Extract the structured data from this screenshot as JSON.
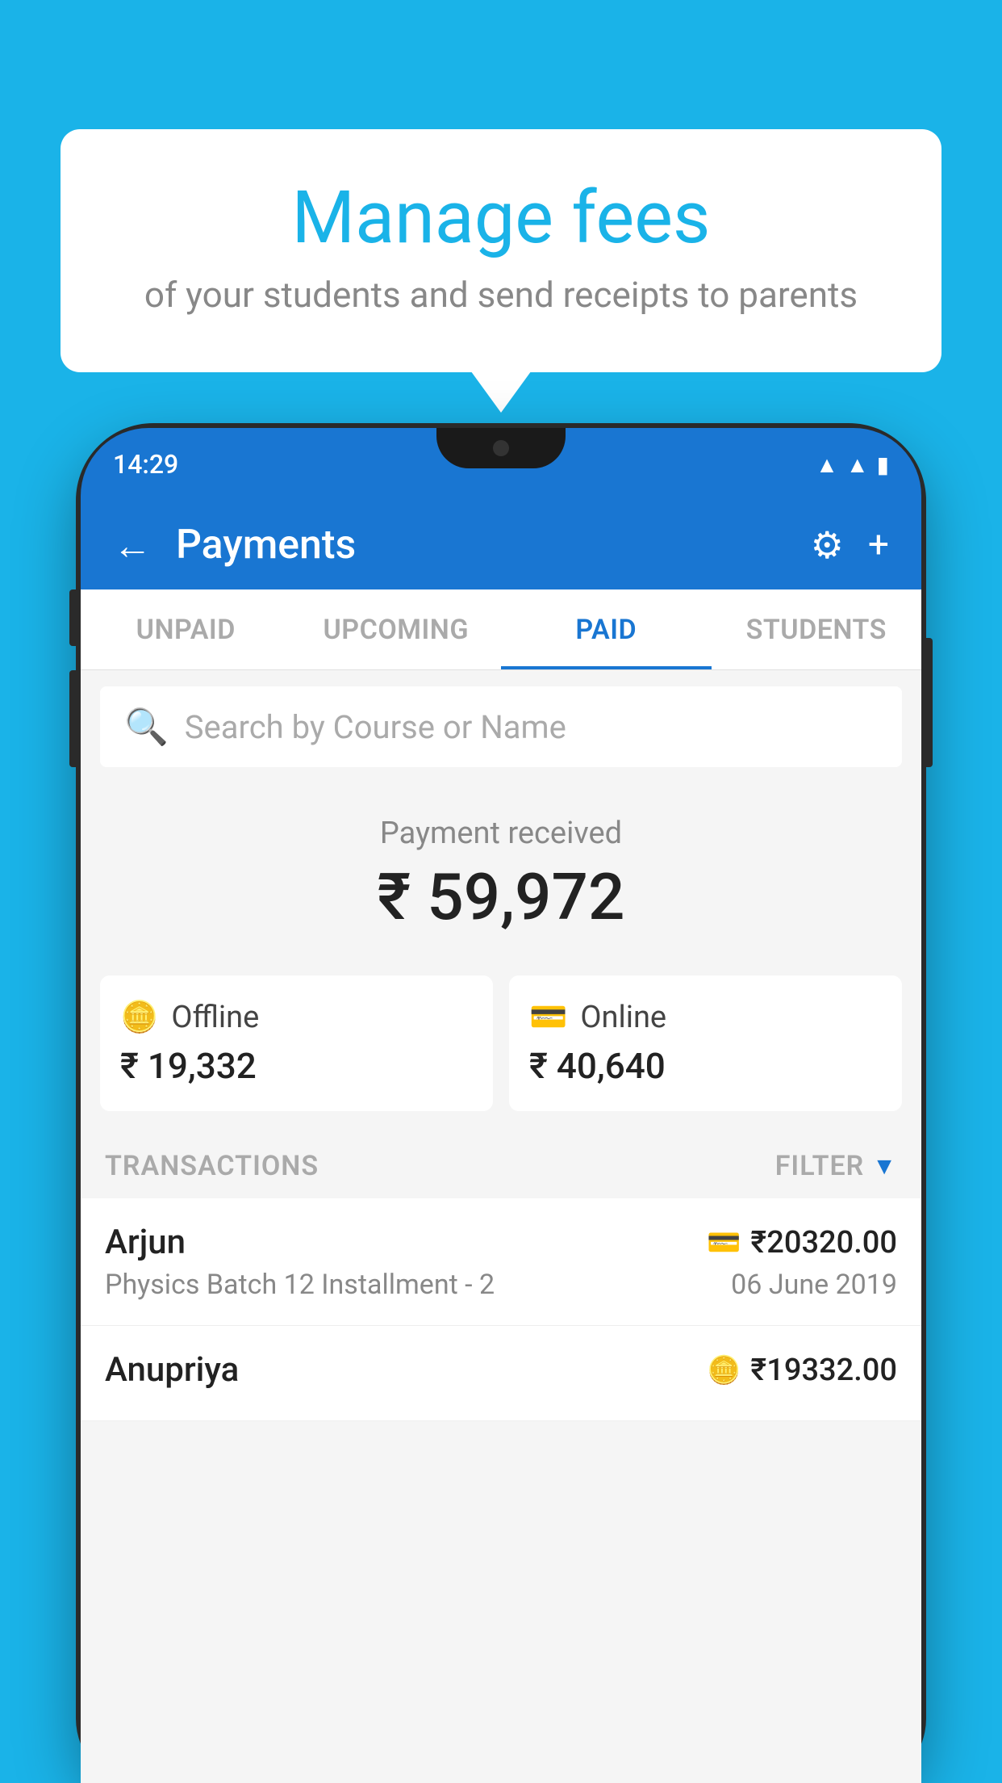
{
  "background_color": "#1ab3e8",
  "speech_bubble": {
    "title": "Manage fees",
    "subtitle": "of your students and send receipts to parents"
  },
  "phone": {
    "status_bar": {
      "time": "14:29"
    },
    "header": {
      "title": "Payments",
      "back_label": "←",
      "gear_label": "⚙",
      "plus_label": "+"
    },
    "tabs": [
      {
        "label": "UNPAID",
        "active": false
      },
      {
        "label": "UPCOMING",
        "active": false
      },
      {
        "label": "PAID",
        "active": true
      },
      {
        "label": "STUDENTS",
        "active": false
      }
    ],
    "search": {
      "placeholder": "Search by Course or Name"
    },
    "payment_summary": {
      "label": "Payment received",
      "amount": "₹ 59,972"
    },
    "payment_cards": [
      {
        "label": "Offline",
        "icon": "💳",
        "amount": "₹ 19,332"
      },
      {
        "label": "Online",
        "icon": "💳",
        "amount": "₹ 40,640"
      }
    ],
    "transactions_section": {
      "label": "TRANSACTIONS",
      "filter_label": "FILTER"
    },
    "transactions": [
      {
        "name": "Arjun",
        "course": "Physics Batch 12 Installment - 2",
        "date": "06 June 2019",
        "amount": "₹20320.00",
        "type": "online"
      },
      {
        "name": "Anupriya",
        "course": "",
        "date": "",
        "amount": "₹19332.00",
        "type": "offline"
      }
    ]
  }
}
